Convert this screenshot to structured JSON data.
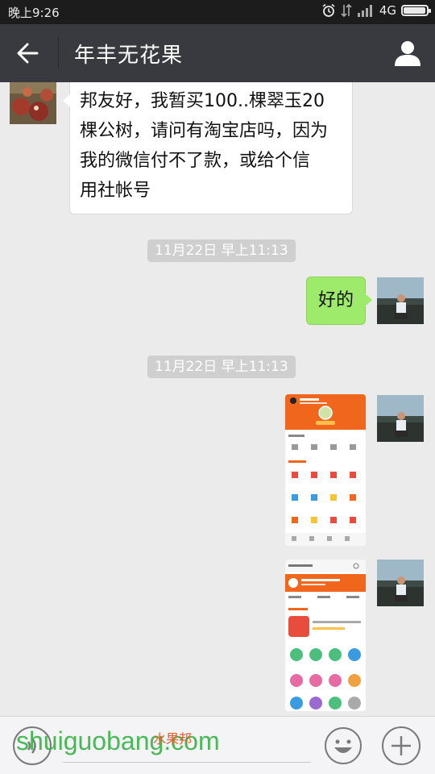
{
  "status_bar": {
    "time": "晚上9:26",
    "network": "4G",
    "icons": [
      "alarm-icon",
      "signal-icon",
      "battery-icon"
    ],
    "battery_level": 0.9
  },
  "header": {
    "title": "年丰无花果",
    "back_icon": "back-arrow-icon",
    "profile_icon": "user-icon"
  },
  "messages": [
    {
      "type": "text",
      "side": "left",
      "text": [
        "邦友好，我暂买100..棵翠玉20",
        "棵公树，请问有淘宝店吗，因为",
        "我的微信付不了款，或给个信",
        "用社帐号"
      ]
    },
    {
      "type": "timestamp",
      "text": "11月22日 早上11:13"
    },
    {
      "type": "text",
      "side": "right",
      "text": "好的"
    },
    {
      "type": "timestamp",
      "text": "11月22日 早上11:13"
    },
    {
      "type": "image",
      "side": "right",
      "description": "screenshot-thumbnail"
    },
    {
      "type": "image",
      "side": "right",
      "description": "screenshot-thumbnail"
    }
  ],
  "bottom_bar": {
    "voice_icon": "voice-icon",
    "emoji_icon": "emoji-icon",
    "plus_icon": "plus-icon"
  },
  "watermark": {
    "text": "shuiguobang.com",
    "cn": "水果邦"
  },
  "colors": {
    "header_bg": "#393a3f",
    "status_bg": "#1c1c1c",
    "chat_bg": "#ebebeb",
    "bubble_right": "#9eea6a",
    "accent_orange": "#f0661c"
  }
}
